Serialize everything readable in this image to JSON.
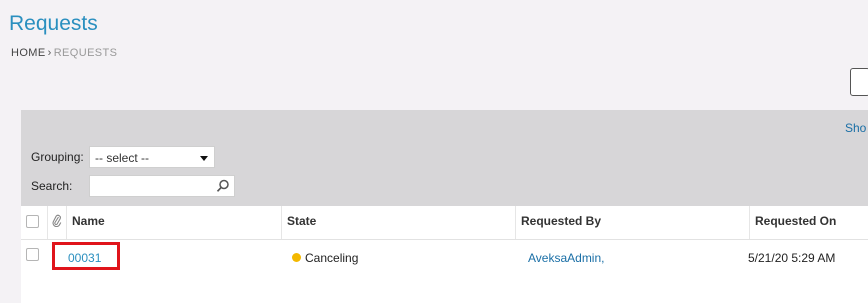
{
  "page": {
    "title": "Requests"
  },
  "breadcrumb": {
    "home": "HOME",
    "separator": "›",
    "current": "REQUESTS"
  },
  "toolbar": {
    "show_link": "Sho",
    "grouping_label": "Grouping:",
    "grouping_value": "-- select --",
    "search_label": "Search:",
    "search_value": ""
  },
  "table": {
    "columns": [
      "Name",
      "State",
      "Requested By",
      "Requested On"
    ],
    "rows": [
      {
        "name": "00031",
        "state": "Canceling",
        "state_color": "#f3b800",
        "requested_by": "AveksaAdmin,",
        "requested_on": "5/21/20 5:29 AM"
      }
    ]
  },
  "colors": {
    "accent": "#2a8fbf",
    "highlight": "#e0141b"
  },
  "icons": {
    "attachment": "paperclip-icon",
    "search": "search-icon"
  }
}
